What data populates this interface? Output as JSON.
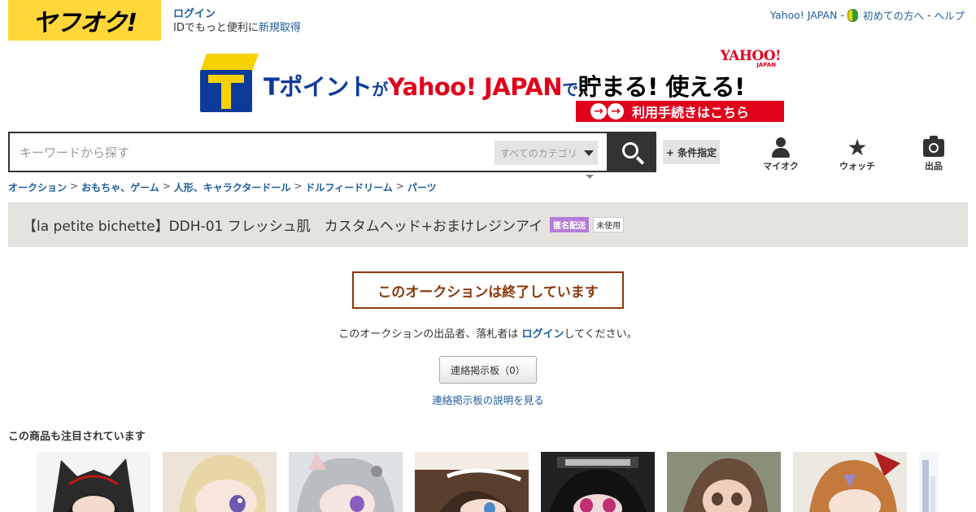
{
  "header": {
    "logo_text": "ヤフオク!",
    "login_label": "ログイン",
    "login_note_prefix": "IDでもっと便利に",
    "register_label": "新規取得",
    "yahoo_japan_label": "Yahoo! JAPAN",
    "beginner_label": "初めての方へ",
    "help_label": "ヘルプ",
    "separator": "-"
  },
  "banner": {
    "t_point": "Tポイント",
    "ga": "が",
    "yahoo_japan": "Yahoo! JAPAN",
    "de": "で",
    "tamaru": "貯まる! 使える!",
    "yahoo_mark": "YAHOO!",
    "yahoo_mark_sub": "JAPAN",
    "cta": "利用手続きはこちら"
  },
  "search": {
    "placeholder": "キーワードから探す",
    "category_label": "すべてのカテゴリ",
    "condition_label": "+ 条件指定"
  },
  "nav": {
    "myauc": "マイオク",
    "watch": "ウォッチ",
    "sell": "出品"
  },
  "breadcrumb": [
    "オークション",
    "おもちゃ、ゲーム",
    "人形、キャラクタードール",
    "ドルフィードリーム",
    "パーツ"
  ],
  "breadcrumb_sep": ">",
  "item": {
    "title": "【la petite bichette】DDH-01 フレッシュ肌　カスタムヘッド+おまけレジンアイ",
    "badge_anonymous": "匿名配送",
    "badge_condition": "未使用"
  },
  "ended": {
    "message": "このオークションは終了しています",
    "note_prefix": "このオークションの出品者、落札者は ",
    "note_link": "ログイン",
    "note_suffix": "してください。",
    "board_button": "連絡掲示板（0）",
    "board_help": "連絡掲示板の説明を見る"
  },
  "related": {
    "title": "この商品も注目されています"
  },
  "colors": {
    "brand_yellow": "#ffd739",
    "link_blue": "#1e5c9b",
    "ended_brown": "#8b3a0e",
    "title_bar_bg": "#e4e3de",
    "badge_purple": "#b57bd8"
  }
}
